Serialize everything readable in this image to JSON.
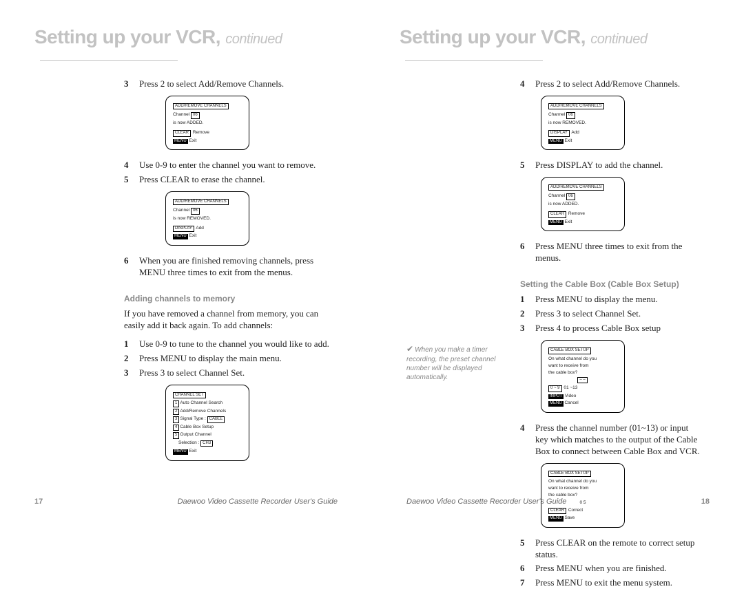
{
  "left": {
    "title_a": "Setting up your VCR,",
    "title_b": "continued",
    "s1": {
      "steps": [
        {
          "n": "3",
          "t": "Press 2 to select Add/Remove Channels."
        }
      ],
      "osd1": {
        "title": "ADD/REMOVE CHANNELS",
        "l1a": "Channel",
        "l1b": "06",
        "l2": "is now ADDED.",
        "b1": "CLEAR",
        "b1v": "Remove",
        "b2": "MENU",
        "b2v": "Exit"
      },
      "steps2": [
        {
          "n": "4",
          "t": "Use 0-9 to enter the channel you want to remove."
        },
        {
          "n": "5",
          "t": "Press CLEAR to erase the channel."
        }
      ],
      "osd2": {
        "title": "ADD/REMOVE CHANNELS",
        "l1a": "Channel",
        "l1b": "06",
        "l2": "is now REMOVED.",
        "b1": "DISPLAY",
        "b1v": "Add",
        "b2": "MENU",
        "b2v": "Exit"
      },
      "steps3": [
        {
          "n": "6",
          "t": "When you are finished removing channels, press MENU three times to exit from the menus."
        }
      ]
    },
    "s2": {
      "heading": "Adding channels to memory",
      "intro": "If you have removed a channel from memory, you can easily add it back again. To add channels:",
      "steps": [
        {
          "n": "1",
          "t": "Use 0-9 to tune to the channel you would like to add."
        },
        {
          "n": "2",
          "t": "Press MENU to display the main menu."
        },
        {
          "n": "3",
          "t": "Press 3 to select Channel Set."
        }
      ],
      "osd": {
        "title": "CHANNEL SET",
        "r1n": "1",
        "r1": "Auto Channel Search",
        "r2n": "2",
        "r2": "Add/Remove Channels",
        "r3n": "3",
        "r3a": "Signal Type   :",
        "r3b": "CABLE",
        "r4n": "4",
        "r4": "Cable Box Setup",
        "r5n": "5",
        "r5a": "Output Channel",
        "r5b": "Selection   :",
        "r5c": "CH3",
        "b1": "MENU",
        "b1v": "Exit"
      }
    },
    "footer_text": "Daewoo Video Cassette Recorder User's Guide",
    "page_num": "17"
  },
  "right": {
    "title_a": "Setting up your VCR,",
    "title_b": "continued",
    "s1": {
      "steps": [
        {
          "n": "4",
          "t": "Press 2 to select Add/Remove Channels."
        }
      ],
      "osd1": {
        "title": "ADD/REMOVE CHANNELS",
        "l1a": "Channel",
        "l1b": "06",
        "l2": "is now REMOVED.",
        "b1": "DISPLAY",
        "b1v": "Add",
        "b2": "MENU",
        "b2v": "Exit"
      },
      "steps2": [
        {
          "n": "5",
          "t": "Press DISPLAY to add the channel."
        }
      ],
      "osd2": {
        "title": "ADD/REMOVE CHANNELS",
        "l1a": "Channel",
        "l1b": "06",
        "l2": "is now ADDED.",
        "b1": "CLEAR",
        "b1v": "Remove",
        "b2": "MENU",
        "b2v": "Exit"
      },
      "steps3": [
        {
          "n": "6",
          "t": "Press MENU three times to exit from the menus."
        }
      ]
    },
    "s2": {
      "heading": "Setting the Cable Box (Cable Box Setup)",
      "steps": [
        {
          "n": "1",
          "t": "Press MENU to display the menu."
        },
        {
          "n": "2",
          "t": "Press 3 to select Channel Set."
        },
        {
          "n": "3",
          "t": "Press 4 to process Cable Box setup"
        }
      ],
      "osd": {
        "title": "CABLE BOX SETUP",
        "q1": "On what channel do you",
        "q2": "want to receive from",
        "q3": "the cable box?",
        "val": "– –",
        "b0": "0 ~ 9",
        "b0v": "01 ~13",
        "b1": "INPUT",
        "b1v": "Video",
        "b2": "MENU",
        "b2v": "Cancel"
      },
      "steps2": [
        {
          "n": "4",
          "t": "Press the channel number (01~13) or input key which matches to the output of the Cable Box to connect between Cable Box and VCR."
        }
      ],
      "osd2": {
        "title": "CABLE BOX SETUP",
        "q1": "On what channel do you",
        "q2": "want to receive from",
        "q3": "the cable box?",
        "val": "0 5",
        "b1": "CLEAR",
        "b1v": "Correct",
        "b2": "MENU",
        "b2v": "Save"
      },
      "steps3": [
        {
          "n": "5",
          "t": "Press CLEAR on the remote to correct setup status."
        },
        {
          "n": "6",
          "t": "Press MENU when you are finished."
        },
        {
          "n": "7",
          "t": "Press MENU to exit the menu system."
        }
      ]
    },
    "aside_check": "✔",
    "aside": "When you make a timer recording, the preset channel number will be displayed automatically.",
    "footer_text": "Daewoo Video Cassette Recorder User's Guide",
    "page_num": "18"
  }
}
